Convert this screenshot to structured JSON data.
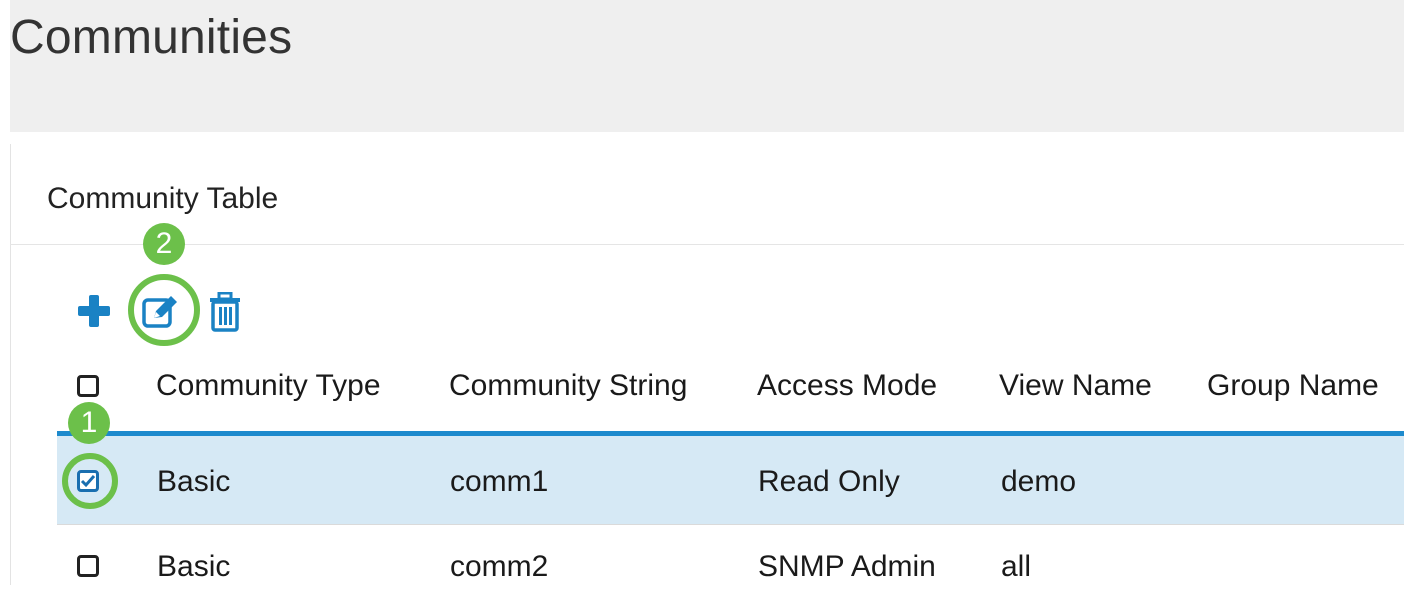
{
  "page": {
    "title": "Communities"
  },
  "section": {
    "title": "Community Table"
  },
  "toolbar": {
    "add_icon": "plus-icon",
    "edit_icon": "edit-icon",
    "delete_icon": "trash-icon"
  },
  "table": {
    "columns": [
      "Community Type",
      "Community String",
      "Access Mode",
      "View Name",
      "Group Name"
    ],
    "rows": [
      {
        "selected": true,
        "type": "Basic",
        "string": "comm1",
        "access": "Read Only",
        "view": "demo",
        "group": ""
      },
      {
        "selected": false,
        "type": "Basic",
        "string": "comm2",
        "access": "SNMP Admin",
        "view": "all",
        "group": ""
      }
    ]
  },
  "annotations": {
    "step1": "1",
    "step2": "2"
  },
  "colors": {
    "accent": "#1d8acd",
    "highlight": "#6cc04a",
    "selected_row": "#d6e9f5"
  }
}
